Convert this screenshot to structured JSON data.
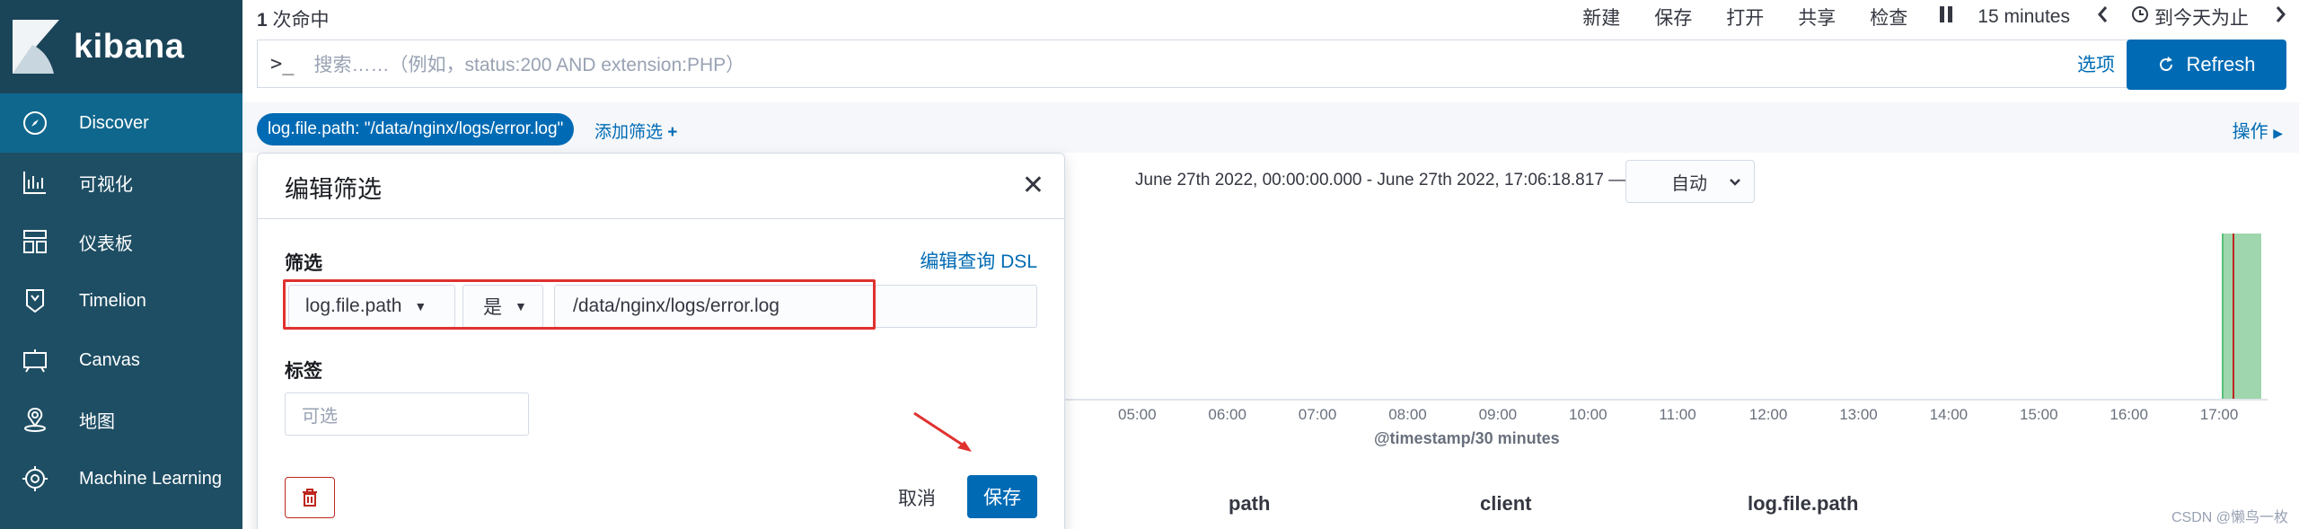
{
  "app": {
    "name": "kibana"
  },
  "sidebar": {
    "items": [
      {
        "label": "Discover",
        "icon": "compass-icon",
        "active": true
      },
      {
        "label": "可视化",
        "icon": "visualize-icon"
      },
      {
        "label": "仪表板",
        "icon": "dashboard-icon"
      },
      {
        "label": "Timelion",
        "icon": "timelion-icon"
      },
      {
        "label": "Canvas",
        "icon": "canvas-icon"
      },
      {
        "label": "地图",
        "icon": "map-icon"
      },
      {
        "label": "Machine Learning",
        "icon": "ml-icon"
      }
    ]
  },
  "topbar": {
    "hits_count": "1",
    "hits_label": "次命中",
    "new": "新建",
    "save": "保存",
    "open": "打开",
    "share": "共享",
    "inspect": "检查",
    "time_interval": "15 minutes",
    "time_range": "到今天为止"
  },
  "search": {
    "prompt": ">_",
    "placeholder": "搜索……（例如，status:200 AND extension:PHP）",
    "options": "选项",
    "refresh": "Refresh"
  },
  "filters": {
    "pill": "log.file.path: \"/data/nginx/logs/error.log\"",
    "add": "添加筛选",
    "actions": "操作"
  },
  "chart": {
    "range": "June 27th 2022, 00:00:00.000 - June 27th 2022, 17:06:18.817 —",
    "interval": "自动",
    "ticks": [
      "05:00",
      "06:00",
      "07:00",
      "08:00",
      "09:00",
      "10:00",
      "11:00",
      "12:00",
      "13:00",
      "14:00",
      "15:00",
      "16:00",
      "17:00"
    ],
    "axis_title": "@timestamp/30 minutes"
  },
  "chart_data": {
    "type": "bar",
    "xlabel": "@timestamp/30 minutes",
    "categories": [
      "05:00",
      "06:00",
      "07:00",
      "08:00",
      "09:00",
      "10:00",
      "11:00",
      "12:00",
      "13:00",
      "14:00",
      "15:00",
      "16:00",
      "17:00"
    ],
    "values": [
      0,
      0,
      0,
      0,
      0,
      0,
      0,
      0,
      0,
      0,
      0,
      0,
      1
    ]
  },
  "table": {
    "columns": [
      "path",
      "client",
      "log.file.path"
    ]
  },
  "modal": {
    "title": "编辑筛选",
    "filter_label": "筛选",
    "dsl_link": "编辑查询 DSL",
    "field": "log.file.path",
    "operator": "是",
    "value": "/data/nginx/logs/error.log",
    "tag_label": "标签",
    "tag_placeholder": "可选",
    "cancel": "取消",
    "save": "保存"
  },
  "watermark": "CSDN @懒鸟一枚",
  "colors": {
    "primary": "#006bb4",
    "sidebar": "#1e4e64",
    "danger": "#bd271e",
    "bar": "#9fd6ad"
  }
}
